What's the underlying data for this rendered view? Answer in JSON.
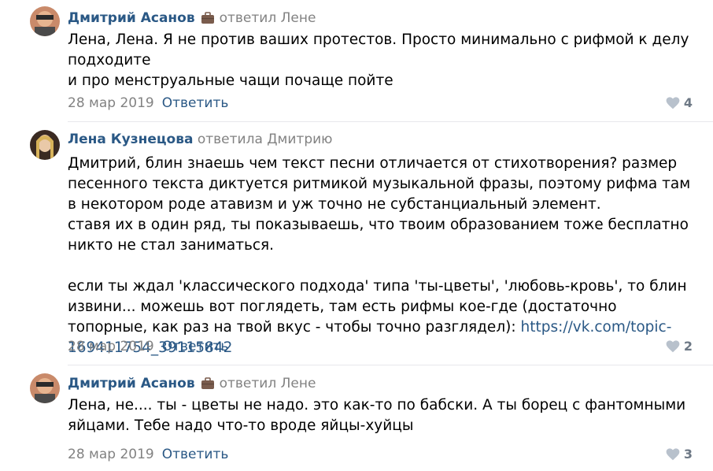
{
  "comments": [
    {
      "author": "Дмитрий Асанов",
      "replied_to": "ответил Лене",
      "lines": [
        "Лена, Лена. Я не против ваших протестов. Просто минимально с рифмой к делу подходите",
        "и про менструальные чащи почаще пойте"
      ],
      "date": "28 мар 2019",
      "reply_label": "Ответить",
      "likes": "4"
    },
    {
      "author": "Лена Кузнецова",
      "replied_to": "ответила Дмитрию",
      "lines": [
        "Дмитрий, блин знаешь чем текст песни отличается от стихотворения? размер песенного текста диктуется ритмикой музыкальной фразы, поэтому рифма там в некотором роде атавизм и уж точно не субстанциальный элемент.",
        "ставя их в один ряд, ты показываешь, что твоим образованием тоже бесплатно никто не стал заниматься.",
        "",
        "если ты ждал 'классического подхода' типа 'ты-цветы', 'любовь-кровь', то блин извини... можешь вот поглядеть, там есть рифмы кое-где (достаточно топорные, как раз на твой вкус - чтобы точно разглядел): "
      ],
      "link": "https://vk.com/topic-169411754_39115842",
      "date": "28 мар 2019",
      "reply_label": "Ответить",
      "likes": "2"
    },
    {
      "author": "Дмитрий Асанов",
      "replied_to": "ответил Лене",
      "lines": [
        "Лена, не.... ты - цветы не надо. это как-то по бабски. А ты борец с фантомными яйцами. Тебе надо что-то вроде яйцы-хуйцы"
      ],
      "date": "28 мар 2019",
      "reply_label": "Ответить",
      "likes": "3"
    }
  ],
  "colors": {
    "author": "#2a5885",
    "muted": "#828282",
    "separator": "#e7e8ec",
    "briefcase": "#7a5c4d"
  },
  "icons": {
    "briefcase": "briefcase-icon",
    "heart": "heart-icon"
  }
}
